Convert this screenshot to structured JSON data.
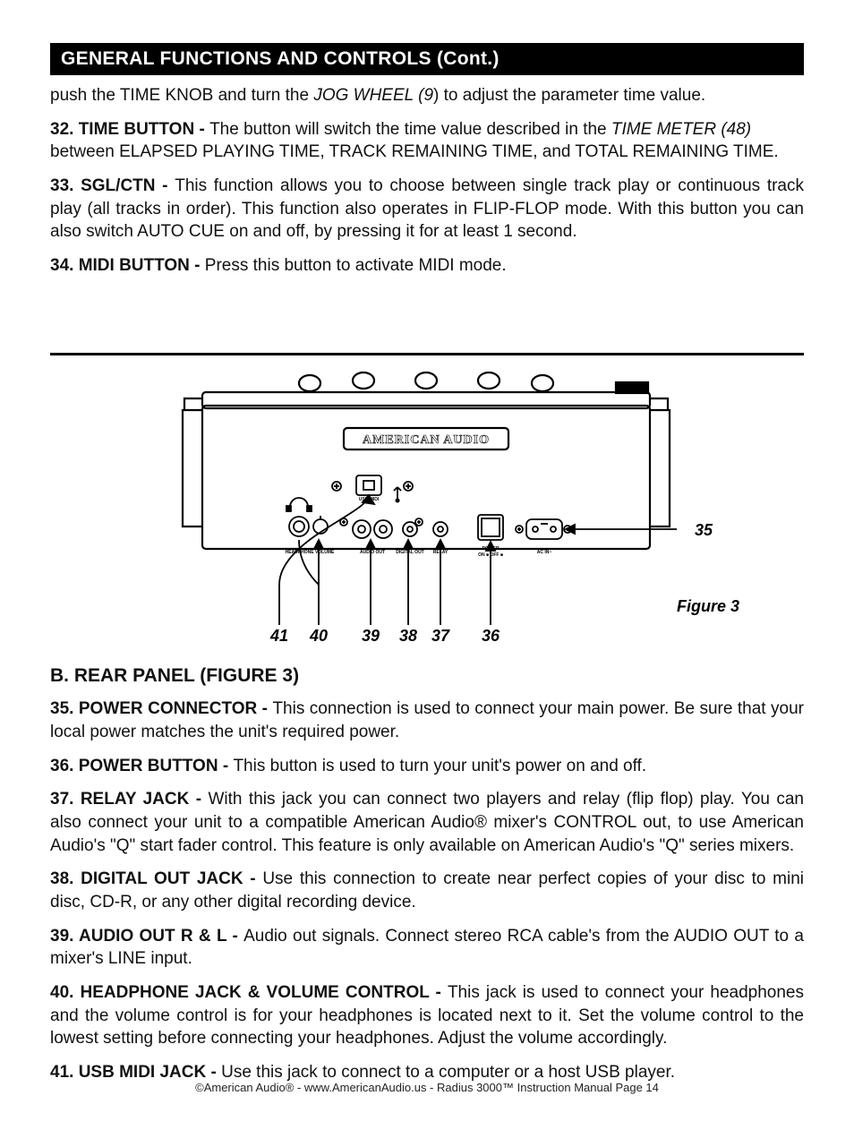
{
  "header": "GENERAL FUNCTIONS AND CONTROLS (Cont.)",
  "intro_line_pre": "push the TIME KNOB and turn the ",
  "intro_line_em": "JOG WHEEL (9",
  "intro_line_post": ") to adjust the parameter time value.",
  "p32_lead": "32. TIME BUTTON - ",
  "p32_body_a": "The button will switch the time value described in the ",
  "p32_em": "TIME METER (48)",
  "p32_body_b": " between ELAPSED PLAYING TIME, TRACK REMAINING TIME, and TOTAL REMAINING TIME.",
  "p33_lead": "33. SGL/CTN - ",
  "p33_body": "This function allows you to choose between single track play or continuous track play (all tracks in order). This function also operates in FLIP-FLOP mode. With this button you can also switch AUTO CUE on and off, by pressing it for at least 1 second.",
  "p34_lead": "34. MIDI BUTTON - ",
  "p34_body": "Press this button to activate MIDI mode.",
  "figure": {
    "brand": "AMERICAN AUDIO",
    "caption": "Figure 3",
    "nums": {
      "n35": "35",
      "n36": "36",
      "n37": "37",
      "n38": "38",
      "n39": "39",
      "n40": "40",
      "n41": "41"
    },
    "labels": {
      "headphone_volume": "HEADPHONE VOLUME",
      "audio_out": "AUDIO OUT",
      "digital_out": "DIGITAL OUT",
      "relay": "RELAY",
      "power": "POWER",
      "on_off": "ON ■ OFF ■",
      "ac_in": "AC IN~",
      "usb_midi": "USB MIDI"
    }
  },
  "rear_title": "B. REAR PANEL (FIGURE 3)",
  "p35_lead": "35. POWER CONNECTOR - ",
  "p35_body": "This connection is used to connect your main power. Be sure that your local power matches the unit's required power.",
  "p36_lead": "36. POWER BUTTON - ",
  "p36_body": "This button is used to turn your unit's power on and off.",
  "p37_lead": "37. RELAY JACK - ",
  "p37_body": "With this jack you can connect two players and relay (flip flop) play. You can also connect your unit to a compatible American Audio® mixer's CONTROL out, to use American Audio's \"Q\" start fader control. This feature is only available on American Audio's \"Q\" series mixers.",
  "p38_lead": "38. DIGITAL OUT JACK - ",
  "p38_body": "Use this connection to create near perfect copies of your disc to mini disc, CD-R, or any other digital recording device.",
  "p39_lead": "39. AUDIO OUT R & L - ",
  "p39_body": "Audio out signals. Connect stereo RCA cable's from the AUDIO OUT to a mixer's LINE input.",
  "p40_lead": "40. HEADPHONE JACK & VOLUME CONTROL - ",
  "p40_body": "This jack is used to connect your headphones and the volume control is for your headphones is located next to it. Set the volume control to the lowest setting before connecting your headphones. Adjust the volume accordingly.",
  "p41_lead": "41. USB MIDI JACK - ",
  "p41_body": "Use this jack to connect to a computer or a host USB player.",
  "footer": "©American Audio®   -   www.AmericanAudio.us   -   Radius 3000™ Instruction Manual Page 14"
}
